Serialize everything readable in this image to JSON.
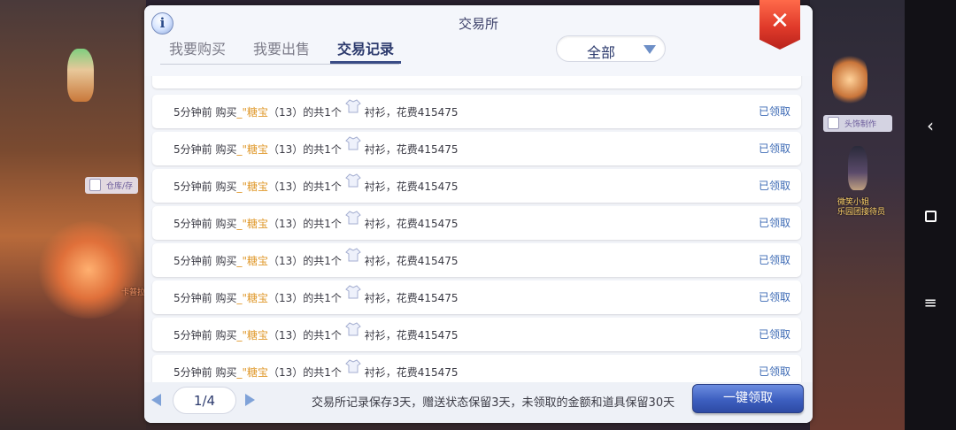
{
  "window": {
    "title": "交易所"
  },
  "tabs": [
    {
      "label": "我要购买"
    },
    {
      "label": "我要出售"
    },
    {
      "label": "交易记录"
    }
  ],
  "filter": {
    "selected": "全部"
  },
  "records": [
    {
      "time": "5分钟前",
      "action": "购买",
      "seller": "_\"糖宝",
      "detail": "（13）的共1个",
      "item": "衬衫，花费415475",
      "status": "已领取"
    },
    {
      "time": "5分钟前",
      "action": "购买",
      "seller": "_\"糖宝",
      "detail": "（13）的共1个",
      "item": "衬衫，花费415475",
      "status": "已领取"
    },
    {
      "time": "5分钟前",
      "action": "购买",
      "seller": "_\"糖宝",
      "detail": "（13）的共1个",
      "item": "衬衫，花费415475",
      "status": "已领取"
    },
    {
      "time": "5分钟前",
      "action": "购买",
      "seller": "_\"糖宝",
      "detail": "（13）的共1个",
      "item": "衬衫，花费415475",
      "status": "已领取"
    },
    {
      "time": "5分钟前",
      "action": "购买",
      "seller": "_\"糖宝",
      "detail": "（13）的共1个",
      "item": "衬衫，花费415475",
      "status": "已领取"
    },
    {
      "time": "5分钟前",
      "action": "购买",
      "seller": "_\"糖宝",
      "detail": "（13）的共1个",
      "item": "衬衫，花费415475",
      "status": "已领取"
    },
    {
      "time": "5分钟前",
      "action": "购买",
      "seller": "_\"糖宝",
      "detail": "（13）的共1个",
      "item": "衬衫，花费415475",
      "status": "已领取"
    },
    {
      "time": "5分钟前",
      "action": "购买",
      "seller": "_\"糖宝",
      "detail": "（13）的共1个",
      "item": "衬衫，花费415475",
      "status": "已领取"
    }
  ],
  "pagination": {
    "page": "1/4"
  },
  "footer": {
    "note": "交易所记录保存3天，赠送状态保留3天，未领取的金额和道具保留30天",
    "claim_all_label": "一键领取"
  },
  "world": {
    "tag_left": "仓库/存",
    "tag_right": "头饰制作",
    "npc_left": "卡普拉",
    "npc_right_line1": "微笑小姐",
    "npc_right_line2": "乐园团接待员"
  },
  "colors": {
    "accent": "#2d3b6e",
    "seller": "#e09a2e",
    "claimed": "#3e6bb5",
    "close": "#e03a2a"
  },
  "icons": {
    "info": "info-icon",
    "close": "close-icon",
    "filter_caret": "caret-down-icon",
    "item": "shirt-icon",
    "prev": "prev-page-icon",
    "next": "next-page-icon",
    "nav_back": "back-chevron-icon",
    "nav_home": "home-square-icon",
    "nav_menu": "menu-lines-icon"
  }
}
